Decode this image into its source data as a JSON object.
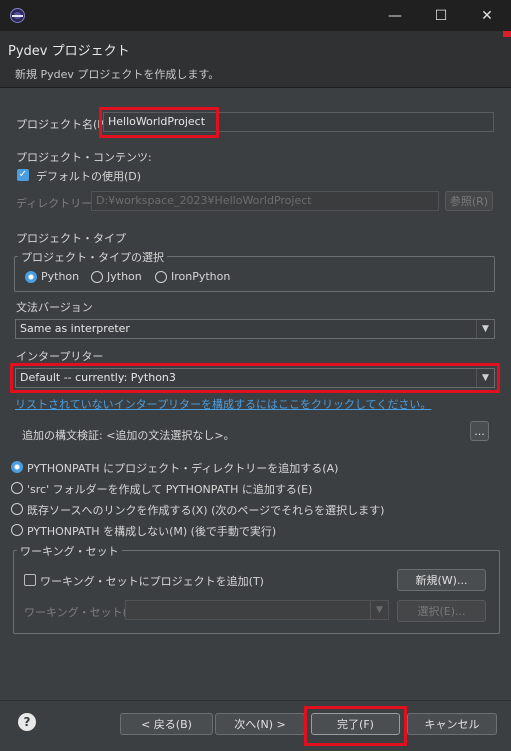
{
  "titlebar": {
    "app_icon": "eclipse-icon",
    "minimize_glyph": "—",
    "maximize_glyph": "☐",
    "close_glyph": "✕"
  },
  "header": {
    "title": "Pydev プロジェクト",
    "description": "新規 Pydev プロジェクトを作成します。"
  },
  "project_name": {
    "label": "プロジェクト名(P):",
    "value": "HelloWorldProject"
  },
  "contents": {
    "label": "プロジェクト・コンテンツ:",
    "use_default_label": "デフォルトの使用(D)",
    "use_default_checked": true,
    "directory_label": "ディレクトリー(Y)",
    "directory_value": "D:¥workspace_2023¥HelloWorldProject",
    "browse_label": "参照(R)"
  },
  "project_type": {
    "label": "プロジェクト・タイプ",
    "group_title": "プロジェクト・タイプの選択",
    "options": [
      "Python",
      "Jython",
      "IronPython"
    ],
    "selected": "Python"
  },
  "grammar": {
    "label": "文法バージョン",
    "value": "Same as interpreter"
  },
  "interpreter": {
    "label": "インタープリター",
    "value": "Default  --  currently: Python3",
    "config_link": "リストされていないインタープリターを構成するにはここをクリックしてください。"
  },
  "syntax": {
    "label": "追加の構文検証: <追加の文法選択なし>。",
    "more_label": "..."
  },
  "pythonpath": {
    "options": [
      "PYTHONPATH にプロジェクト・ディレクトリーを追加する(A)",
      "'src' フォルダーを作成して PYTHONPATH に追加する(E)",
      "既存ソースへのリンクを作成する(X) (次のページでそれらを選択します)",
      "PYTHONPATH を構成しない(M) (後で手動で実行)"
    ],
    "selected_index": 0
  },
  "working_set": {
    "group_title": "ワーキング・セット",
    "add_label": "ワーキング・セットにプロジェクトを追加(T)",
    "add_checked": false,
    "new_label": "新規(W)...",
    "set_label": "ワーキング・セット(O):",
    "set_value": "",
    "select_label": "選択(E)..."
  },
  "footer": {
    "back_label": "< 戻る(B)",
    "next_label": "次へ(N) >",
    "finish_label": "完了(F)",
    "cancel_label": "キャンセル"
  },
  "colors": {
    "highlight": "#e0101e",
    "accent": "#4a9ee0"
  }
}
